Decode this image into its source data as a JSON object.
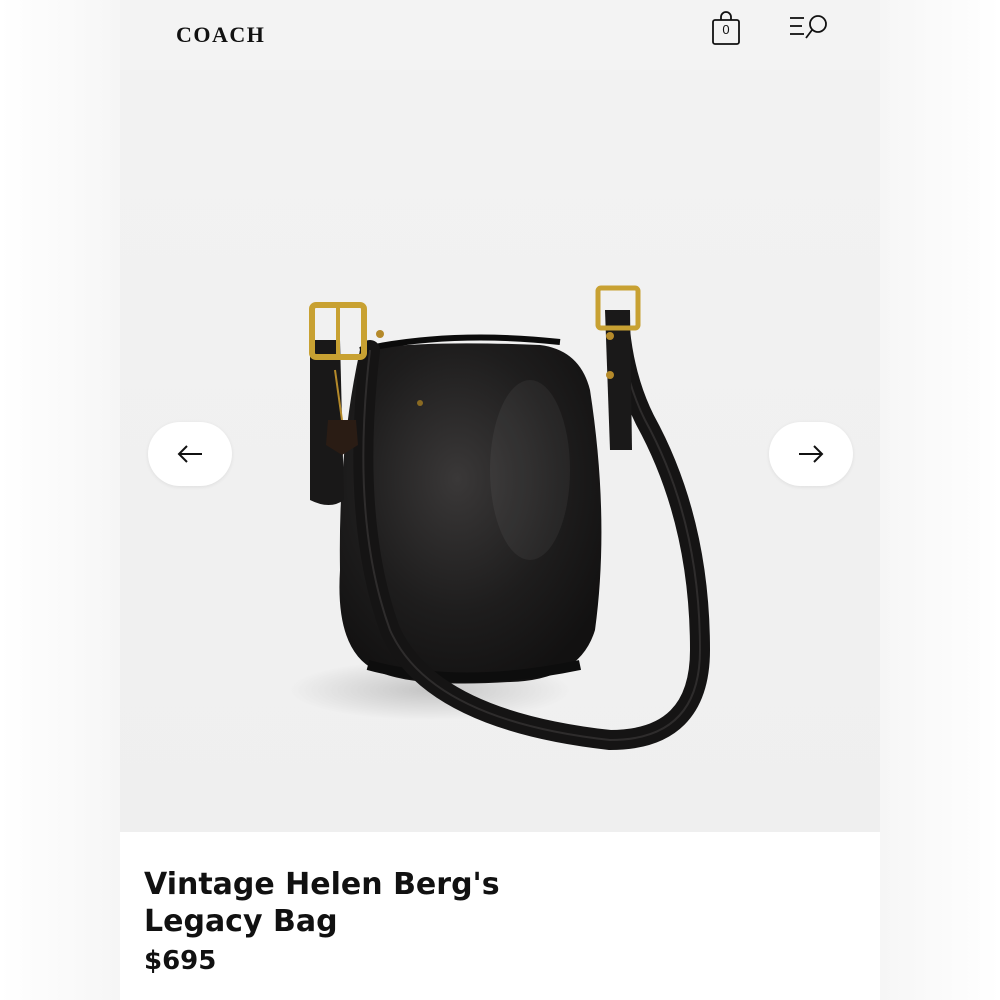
{
  "header": {
    "logo_text": "COACH",
    "bag_count": "0",
    "bag_icon": "shopping-bag-icon",
    "menu_icon": "menu-search-icon"
  },
  "gallery": {
    "prev_icon": "arrow-left-icon",
    "next_icon": "arrow-right-icon",
    "image_subject": "black leather bucket bag"
  },
  "product": {
    "title_line1": "Vintage Helen Berg's",
    "title_line2": "Legacy Bag",
    "price": "$695"
  },
  "colors": {
    "page_bg": "#f3f3f3",
    "text": "#111111",
    "bag_leather": "#1b1a1a",
    "hardware_brass": "#c8a132"
  }
}
